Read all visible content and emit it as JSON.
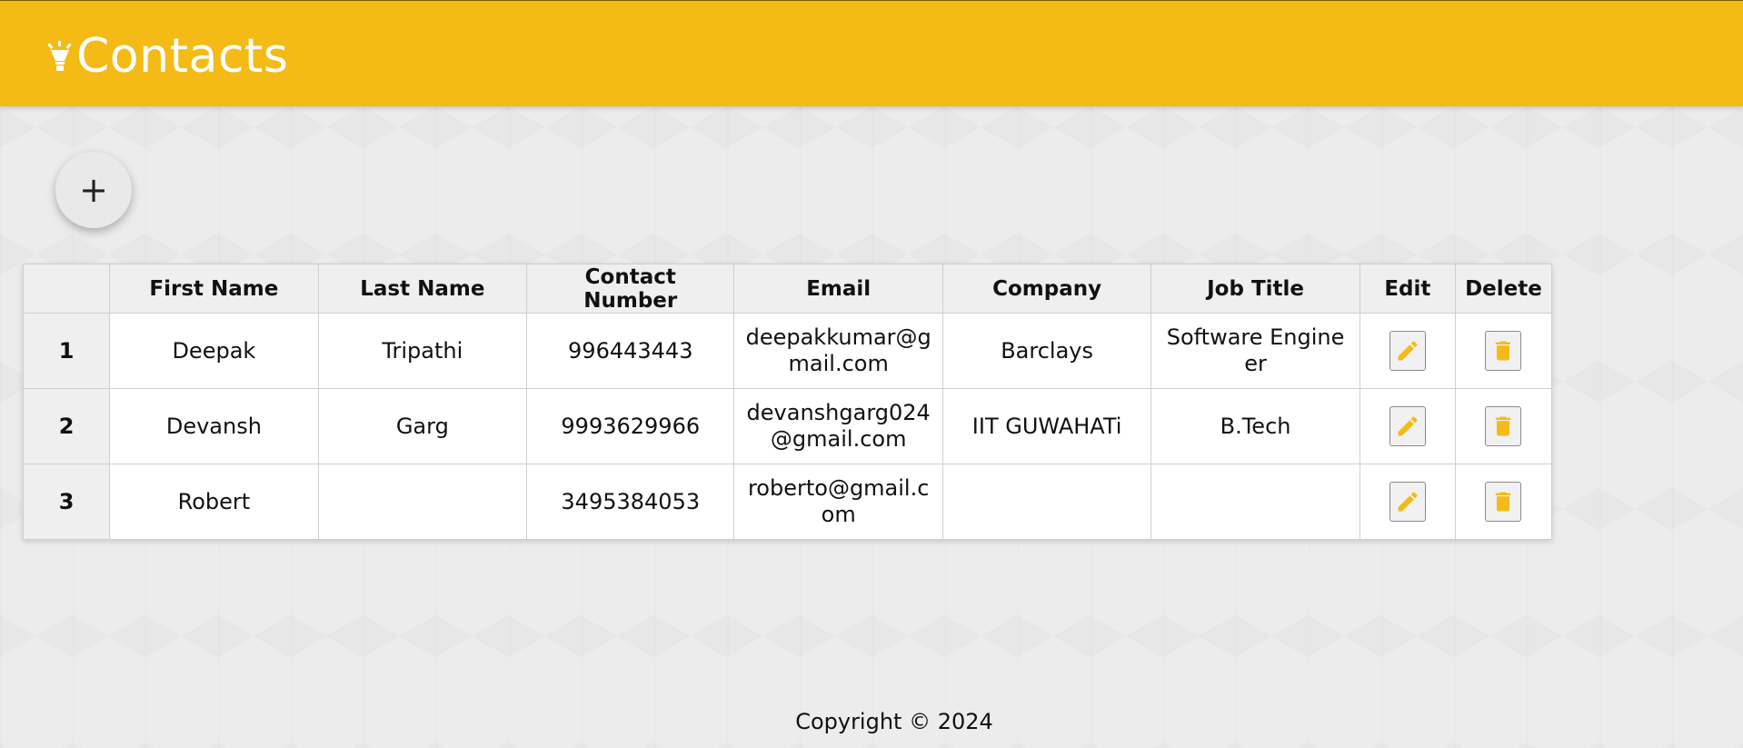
{
  "header": {
    "title": "Contacts",
    "logo_icon": "lightbulb-icon",
    "background_color": "#f4bb17"
  },
  "add_button": {
    "label": "+",
    "icon": "plus-icon"
  },
  "table": {
    "columns": [
      "",
      "First Name",
      "Last Name",
      "Contact Number",
      "Email",
      "Company",
      "Job Title",
      "Edit",
      "Delete"
    ],
    "rows": [
      {
        "index": "1",
        "first_name": "Deepak",
        "last_name": "Tripathi",
        "contact_number": "996443443",
        "email": "deepakkumar@gmail.com",
        "company": "Barclays",
        "job_title": "Software Engineer"
      },
      {
        "index": "2",
        "first_name": "Devansh",
        "last_name": "Garg",
        "contact_number": "9993629966",
        "email": "devanshgarg024@gmail.com",
        "company": "IIT GUWAHATi",
        "job_title": "B.Tech"
      },
      {
        "index": "3",
        "first_name": "Robert",
        "last_name": "",
        "contact_number": "3495384053",
        "email": "roberto@gmail.com",
        "company": "",
        "job_title": ""
      }
    ],
    "edit_icon": "pencil-icon",
    "delete_icon": "trash-icon",
    "icon_color": "#f4bb17"
  },
  "footer": {
    "text": "Copyright © 2024"
  }
}
